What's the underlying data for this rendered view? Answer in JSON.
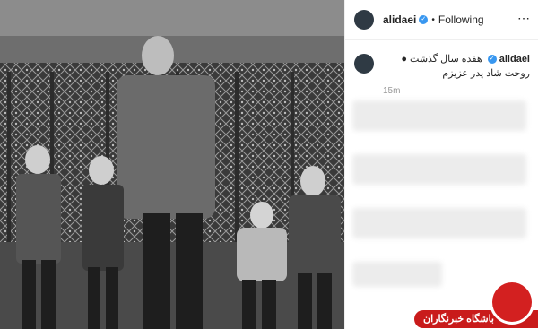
{
  "post": {
    "image_description_alt": "",
    "username": "alidaei",
    "follow_status": "Following",
    "dot_separator": "•",
    "more_icon": "⋯",
    "caption_user": "alidaei",
    "caption_text": "هفده سال گذشت ● روحت شاد پدر عزیزم",
    "timestamp": "15m"
  },
  "watermark": {
    "text": "باشگاه خبرنگاران"
  },
  "colors": {
    "verified": "#3897f0",
    "watermark_red": "#c91b1b"
  }
}
